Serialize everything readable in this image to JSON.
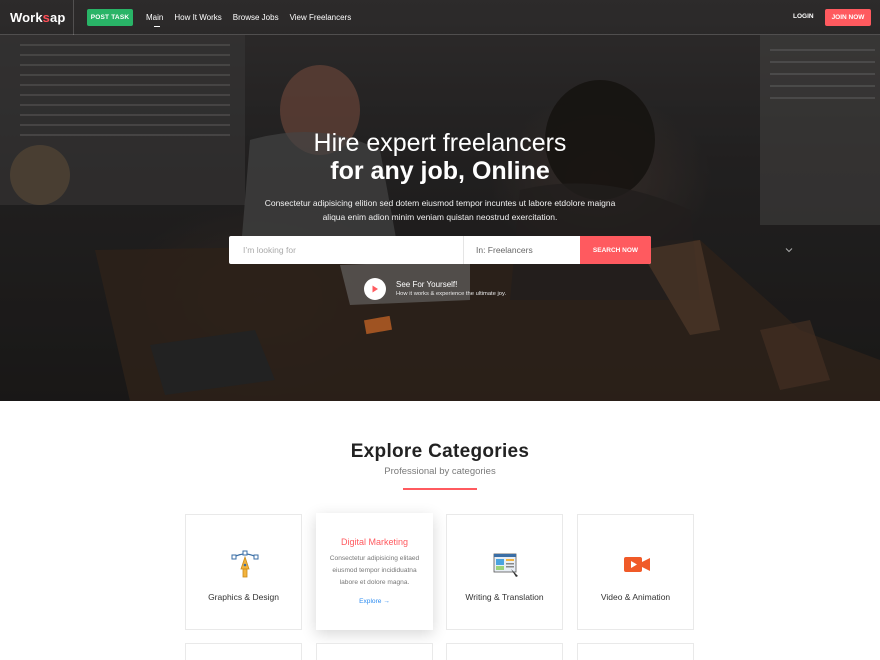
{
  "nav": {
    "logo_part1": "Work",
    "logo_accent": "s",
    "logo_part2": "ap",
    "post_task": "POST TASK",
    "links": [
      "Main",
      "How It Works",
      "Browse Jobs",
      "View Freelancers"
    ],
    "login": "LOGIN",
    "join": "JOIN NOW"
  },
  "hero": {
    "title_line1": "Hire expert freelancers",
    "title_line2": "for any job, Online",
    "description": "Consectetur adipisicing elition sed dotem eiusmod tempor incuntes ut labore etdolore maigna aliqua enim adion minim veniam quistan neostrud exercitation.",
    "search_placeholder": "I’m looking for",
    "search_in": "In: Freelancers",
    "search_button": "SEARCH NOW",
    "video_title": "See For Yourself!",
    "video_subtitle": "How it works & experience the ultimate joy."
  },
  "categories": {
    "title": "Explore Categories",
    "subtitle": "Professional by categories",
    "items": [
      {
        "label": "Graphics & Design",
        "icon": "graphics-design-icon"
      },
      {
        "label": "Digital Marketing",
        "description": "Consectetur adipisicing elitaed eiusmod tempor incididuatna labore et dolore magna.",
        "link": "Explore"
      },
      {
        "label": "Writing & Translation",
        "icon": "writing-translation-icon"
      },
      {
        "label": "Video & Animation",
        "icon": "video-camera-icon"
      }
    ]
  },
  "colors": {
    "accent": "#ff5a5f",
    "green": "#29b467",
    "link": "#2d8cf0"
  }
}
